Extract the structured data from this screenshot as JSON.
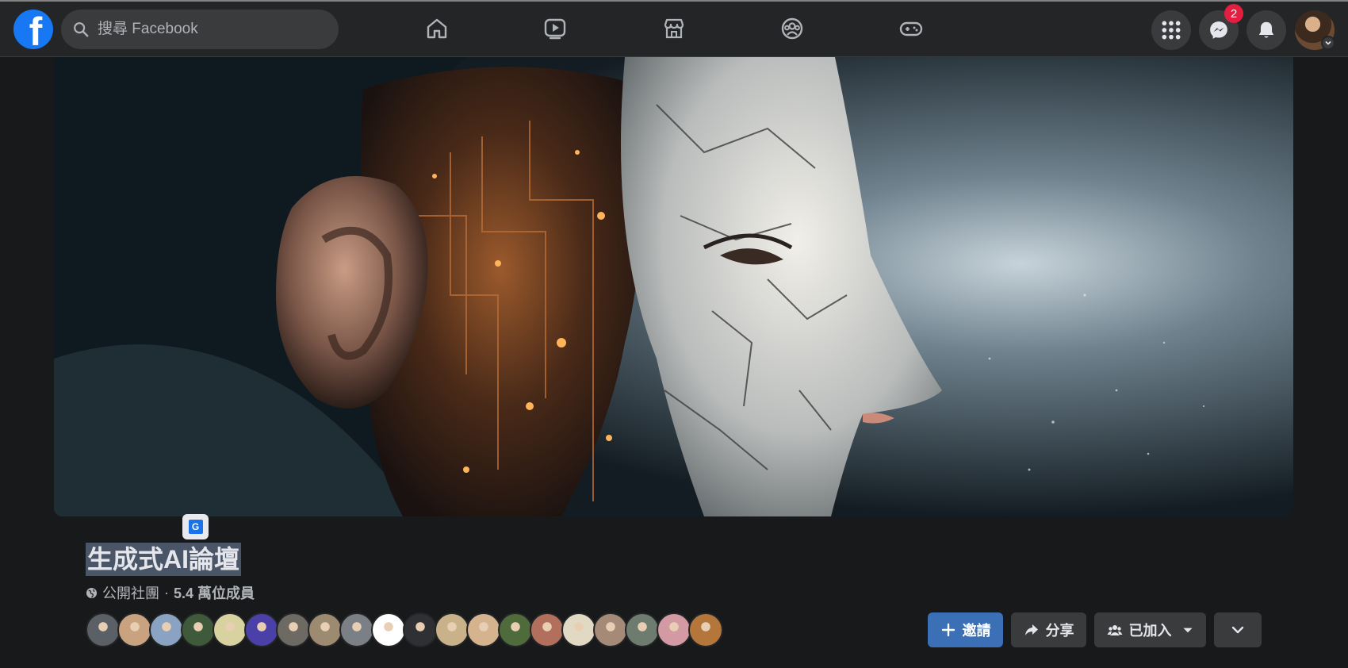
{
  "topbar": {
    "logo_letter": "f",
    "search_placeholder": "搜尋 Facebook",
    "nav_icons": [
      "home-icon",
      "video-icon",
      "marketplace-icon",
      "groups-icon",
      "gaming-icon"
    ],
    "messenger_badge": "2"
  },
  "group": {
    "name": "生成式AI論壇",
    "privacy": "公開社團",
    "separator": "·",
    "member_count": "5.4 萬位成員",
    "member_avatar_colors": [
      "#5b5f66",
      "#c9a37f",
      "#8aa3c2",
      "#3f5a3a",
      "#d8d2a0",
      "#4b3fa8",
      "#6d6a64",
      "#9c8b70",
      "#7b7f86",
      "#ffffff",
      "#2f3033",
      "#c9b28a",
      "#d6b38f",
      "#4f6b3c",
      "#b2705c",
      "#e2d9c4",
      "#a58a78",
      "#6e7c70",
      "#d39aa3",
      "#b5763c"
    ]
  },
  "actions": {
    "invite_label": "邀請",
    "share_label": "分享",
    "joined_label": "已加入"
  },
  "colors": {
    "accent": "#1877f2",
    "badge": "#e41e3f",
    "invite_button": "#3b6fb6"
  }
}
